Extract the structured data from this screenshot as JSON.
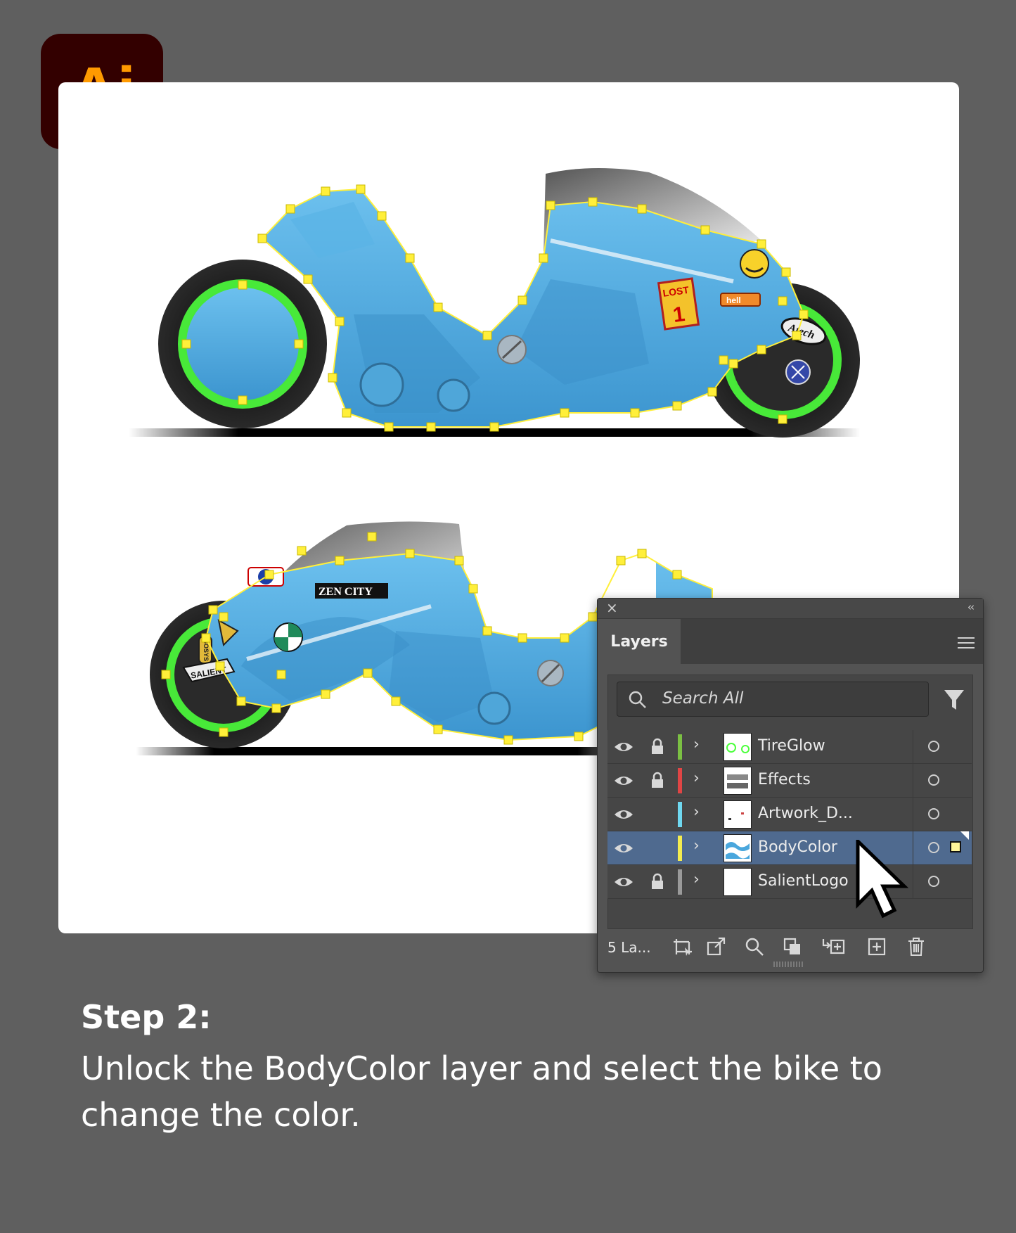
{
  "logo": {
    "text": "Ai",
    "bg": "#330000",
    "fg": "#ff9a00"
  },
  "artboard": {
    "bike_color": "#4aa7dd",
    "glow_color": "#4cff3c",
    "anchor_color": "#ffef3a",
    "decals_top": [
      "LOST",
      "1",
      "hell",
      "Atech"
    ],
    "decals_bottom": [
      "ZEN CITY",
      "SALIENT",
      "SOSYS"
    ]
  },
  "panel": {
    "tab_label": "Layers",
    "search_placeholder": "Search All",
    "layer_count": "5 La...",
    "layers": [
      {
        "name": "TireGlow",
        "locked": true,
        "color": "#7bc043",
        "selected": false
      },
      {
        "name": "Effects",
        "locked": true,
        "color": "#e04545",
        "selected": false
      },
      {
        "name": "Artwork_D...",
        "locked": false,
        "color": "#6fd8f0",
        "selected": false
      },
      {
        "name": "BodyColor",
        "locked": false,
        "color": "#f4ec4f",
        "selected": true
      },
      {
        "name": "SalientLogo",
        "locked": true,
        "color": "#9a9a9a",
        "selected": false
      }
    ],
    "icons": [
      "close-icon",
      "collapse-icon",
      "menu-icon",
      "search-icon",
      "filter-icon",
      "eye-icon",
      "lock-icon",
      "chevron-right-icon",
      "target-icon",
      "artboard-icon",
      "export-icon",
      "locate-object-icon",
      "clipping-mask-icon",
      "new-sublayer-icon",
      "new-layer-icon",
      "trash-icon"
    ]
  },
  "caption": {
    "title": "Step 2:",
    "body": "Unlock the BodyColor layer and select the bike to change the color."
  }
}
